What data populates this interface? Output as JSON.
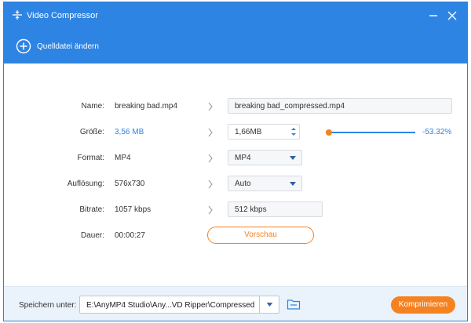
{
  "window": {
    "title": "Video Compressor",
    "icon": "compress-icon"
  },
  "toolbar": {
    "source_label": "Quelldatei ändern",
    "source_icon": "plus-circle-icon"
  },
  "form": {
    "name": {
      "label": "Name:",
      "value": "breaking bad.mp4",
      "output": "breaking bad_compressed.mp4"
    },
    "size": {
      "label": "Größe:",
      "value": "3,56 MB",
      "output": "1,66MB",
      "percent": "-53.32%",
      "slider_fraction": 0.0
    },
    "format": {
      "label": "Format:",
      "value": "MP4",
      "selected": "MP4"
    },
    "resolution": {
      "label": "Auflösung:",
      "value": "576x730",
      "selected": "Auto"
    },
    "bitrate": {
      "label": "Bitrate:",
      "value": "1057 kbps",
      "output": "512 kbps"
    },
    "duration": {
      "label": "Dauer:",
      "value": "00:00:27",
      "preview_label": "Vorschau"
    }
  },
  "footer": {
    "save_label": "Speichern unter:",
    "path": "E:\\AnyMP4 Studio\\Any...VD Ripper\\Compressed",
    "compress_label": "Komprimieren"
  },
  "colors": {
    "accent": "#2e84e3",
    "orange": "#f58220",
    "footer_bg": "#eaf2fb"
  }
}
